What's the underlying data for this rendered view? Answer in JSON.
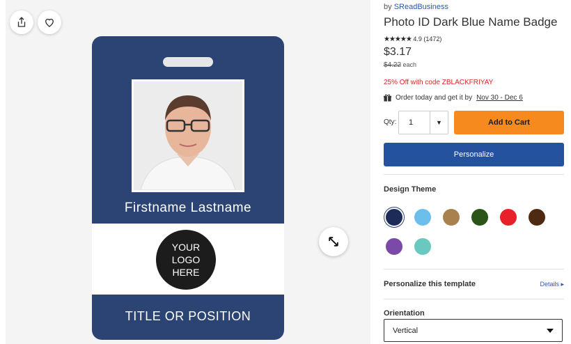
{
  "product": {
    "by_prefix": "by",
    "seller": "SReadBusiness",
    "title": "Photo ID Dark Blue Name Badge",
    "stars": "★★★★★",
    "rating": "4.9 (1472)",
    "price": "$3.17",
    "old_price": "$4.22",
    "old_price_suffix": "each",
    "promo": "25% Off with code ZBLACKFRIYAY",
    "delivery_prefix": "Order today and get it by",
    "delivery_dates": "Nov 30 - Dec 6"
  },
  "badge": {
    "name": "Firstname Lastname",
    "logo_line1": "YOUR",
    "logo_line2": "LOGO",
    "logo_line3": "HERE",
    "title": "TITLE OR POSITION"
  },
  "purchase": {
    "qty_label": "Qty:",
    "qty_value": "1",
    "add_to_cart": "Add to Cart",
    "personalize": "Personalize"
  },
  "design_theme": {
    "label": "Design Theme",
    "selected_index": 0,
    "colors": [
      "#1c2b57",
      "#6bbfea",
      "#a9814e",
      "#2b5418",
      "#e8202a",
      "#4e2a12",
      "#7b4aa8",
      "#69c8c0"
    ]
  },
  "personalize_template": {
    "label": "Personalize this template",
    "details_link": "Details ▸"
  },
  "orientation": {
    "label": "Orientation",
    "value": "Vertical"
  },
  "icons": [
    "share-icon",
    "heart-icon",
    "expand-icon",
    "gift-icon",
    "chevron-down-icon"
  ]
}
